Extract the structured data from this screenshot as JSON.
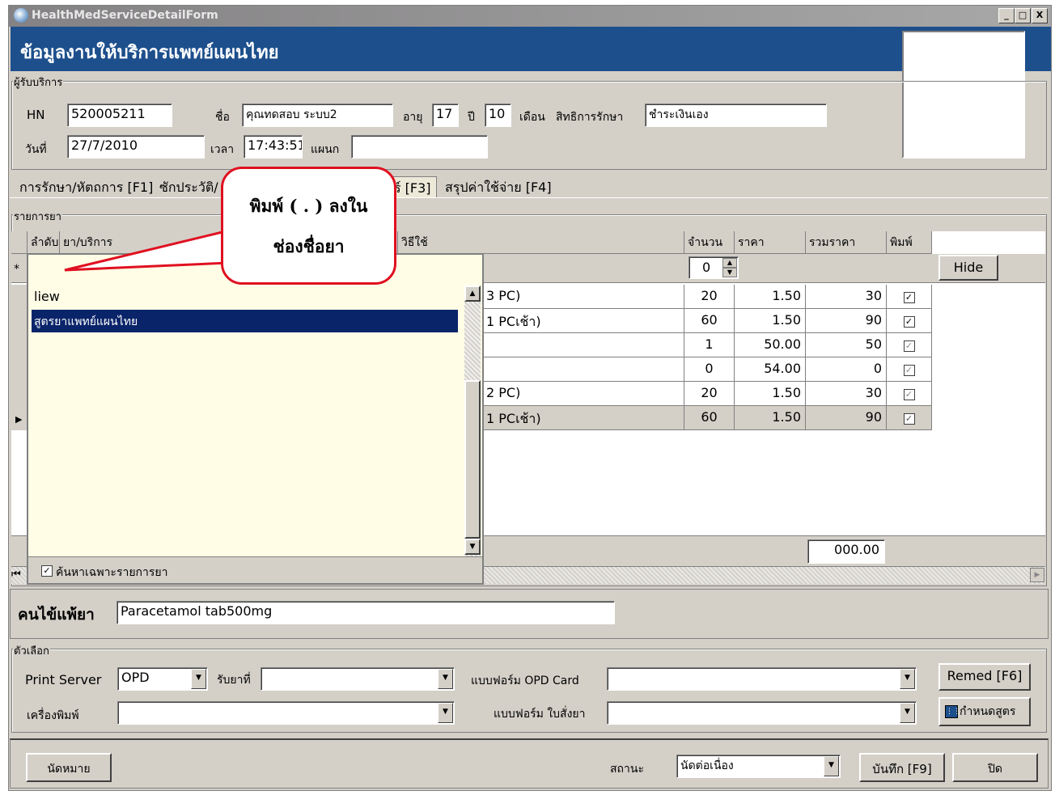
{
  "window": {
    "title": "HealthMedServiceDetailForm",
    "min": "_",
    "max": "□",
    "close": "X"
  },
  "banner": {
    "title": "ข้อมูลงานให้บริการแพทย์แผนไทย"
  },
  "patient": {
    "group_label": "ผู้รับบริการ",
    "hn_label": "HN",
    "hn": "520005211",
    "name_label": "ชื่อ",
    "name": "คุณทดสอบ ระบบ2",
    "age_label": "อายุ",
    "age_years": "17",
    "year_label": "ปี",
    "age_months": "10",
    "month_label": "เดือน",
    "right_label": "สิทธิการรักษา",
    "right": "ชำระเงินเอง",
    "date_label": "วันที่",
    "date": "27/7/2010",
    "time_label": "เวลา",
    "time": "17:43:51",
    "dept_label": "แผนก",
    "dept": ""
  },
  "tabs": [
    "การรักษา/หัตถการ [F1]",
    "ซักประวัติ/",
    "ร์ [F3]",
    "สรุปค่าใช้จ่าย [F4]"
  ],
  "drugs": {
    "group_label": "รายการยา",
    "headers": [
      "ลำดับ",
      "ยา/บริการ",
      "วิธีใช้",
      "จำนวน",
      "ราคา",
      "รวมราคา",
      "พิมพ์"
    ],
    "new_row": {
      "marker": "*",
      "name": ".",
      "qty": "0"
    },
    "hide_button": "Hide",
    "rows": [
      {
        "usage": "3 PC)",
        "qty": "20",
        "price": "1.50",
        "total": "30",
        "print": "✓"
      },
      {
        "usage": "1 PCเช้า)",
        "qty": "60",
        "price": "1.50",
        "total": "90",
        "print": "✓"
      },
      {
        "usage": "",
        "qty": "1",
        "price": "50.00",
        "total": "50",
        "print": "✓"
      },
      {
        "usage": "",
        "qty": "0",
        "price": "54.00",
        "total": "0",
        "print": "✓"
      },
      {
        "usage": "2 PC)",
        "qty": "20",
        "price": "1.50",
        "total": "30",
        "print": "✓"
      },
      {
        "usage": "1 PCเช้า)",
        "qty": "60",
        "price": "1.50",
        "total": "90",
        "print": "✓"
      }
    ],
    "sum": "000.00",
    "current_marker": "▶",
    "first_marker": "⏮"
  },
  "dropdown": {
    "items": [
      "liew",
      "สูตรยาแพทย์แผนไทย"
    ],
    "selected_index": 1,
    "search_only_label": "ค้นหาเฉพาะรายการยา",
    "search_only_checked": "✓"
  },
  "callout": {
    "line1": "พิมพ์ ( . ) ลงใน",
    "line2": "ช่องชื่อยา"
  },
  "allergy": {
    "label": "คนไข้แพ้ยา",
    "value": "Paracetamol tab500mg"
  },
  "options": {
    "group_label": "ตัวเลือก",
    "print_server_label": "Print Server",
    "print_server": "OPD",
    "receive_label": "รับยาที่",
    "receive": "",
    "opd_card_label": "แบบฟอร์ม OPD Card",
    "opd_card": "",
    "printer_label": "เครื่องพิมพ์",
    "printer": "",
    "order_form_label": "แบบฟอร์ม ใบสั่งยา",
    "order_form": "",
    "remed_button": "Remed [F6]",
    "formula_button": "กำหนดสูตร"
  },
  "footer": {
    "appointment_button": "นัดหมาย",
    "status_label": "สถานะ",
    "status": "นัดต่อเนื่อง",
    "save_button": "บันทึก [F9]",
    "close_button": "ปิด"
  }
}
